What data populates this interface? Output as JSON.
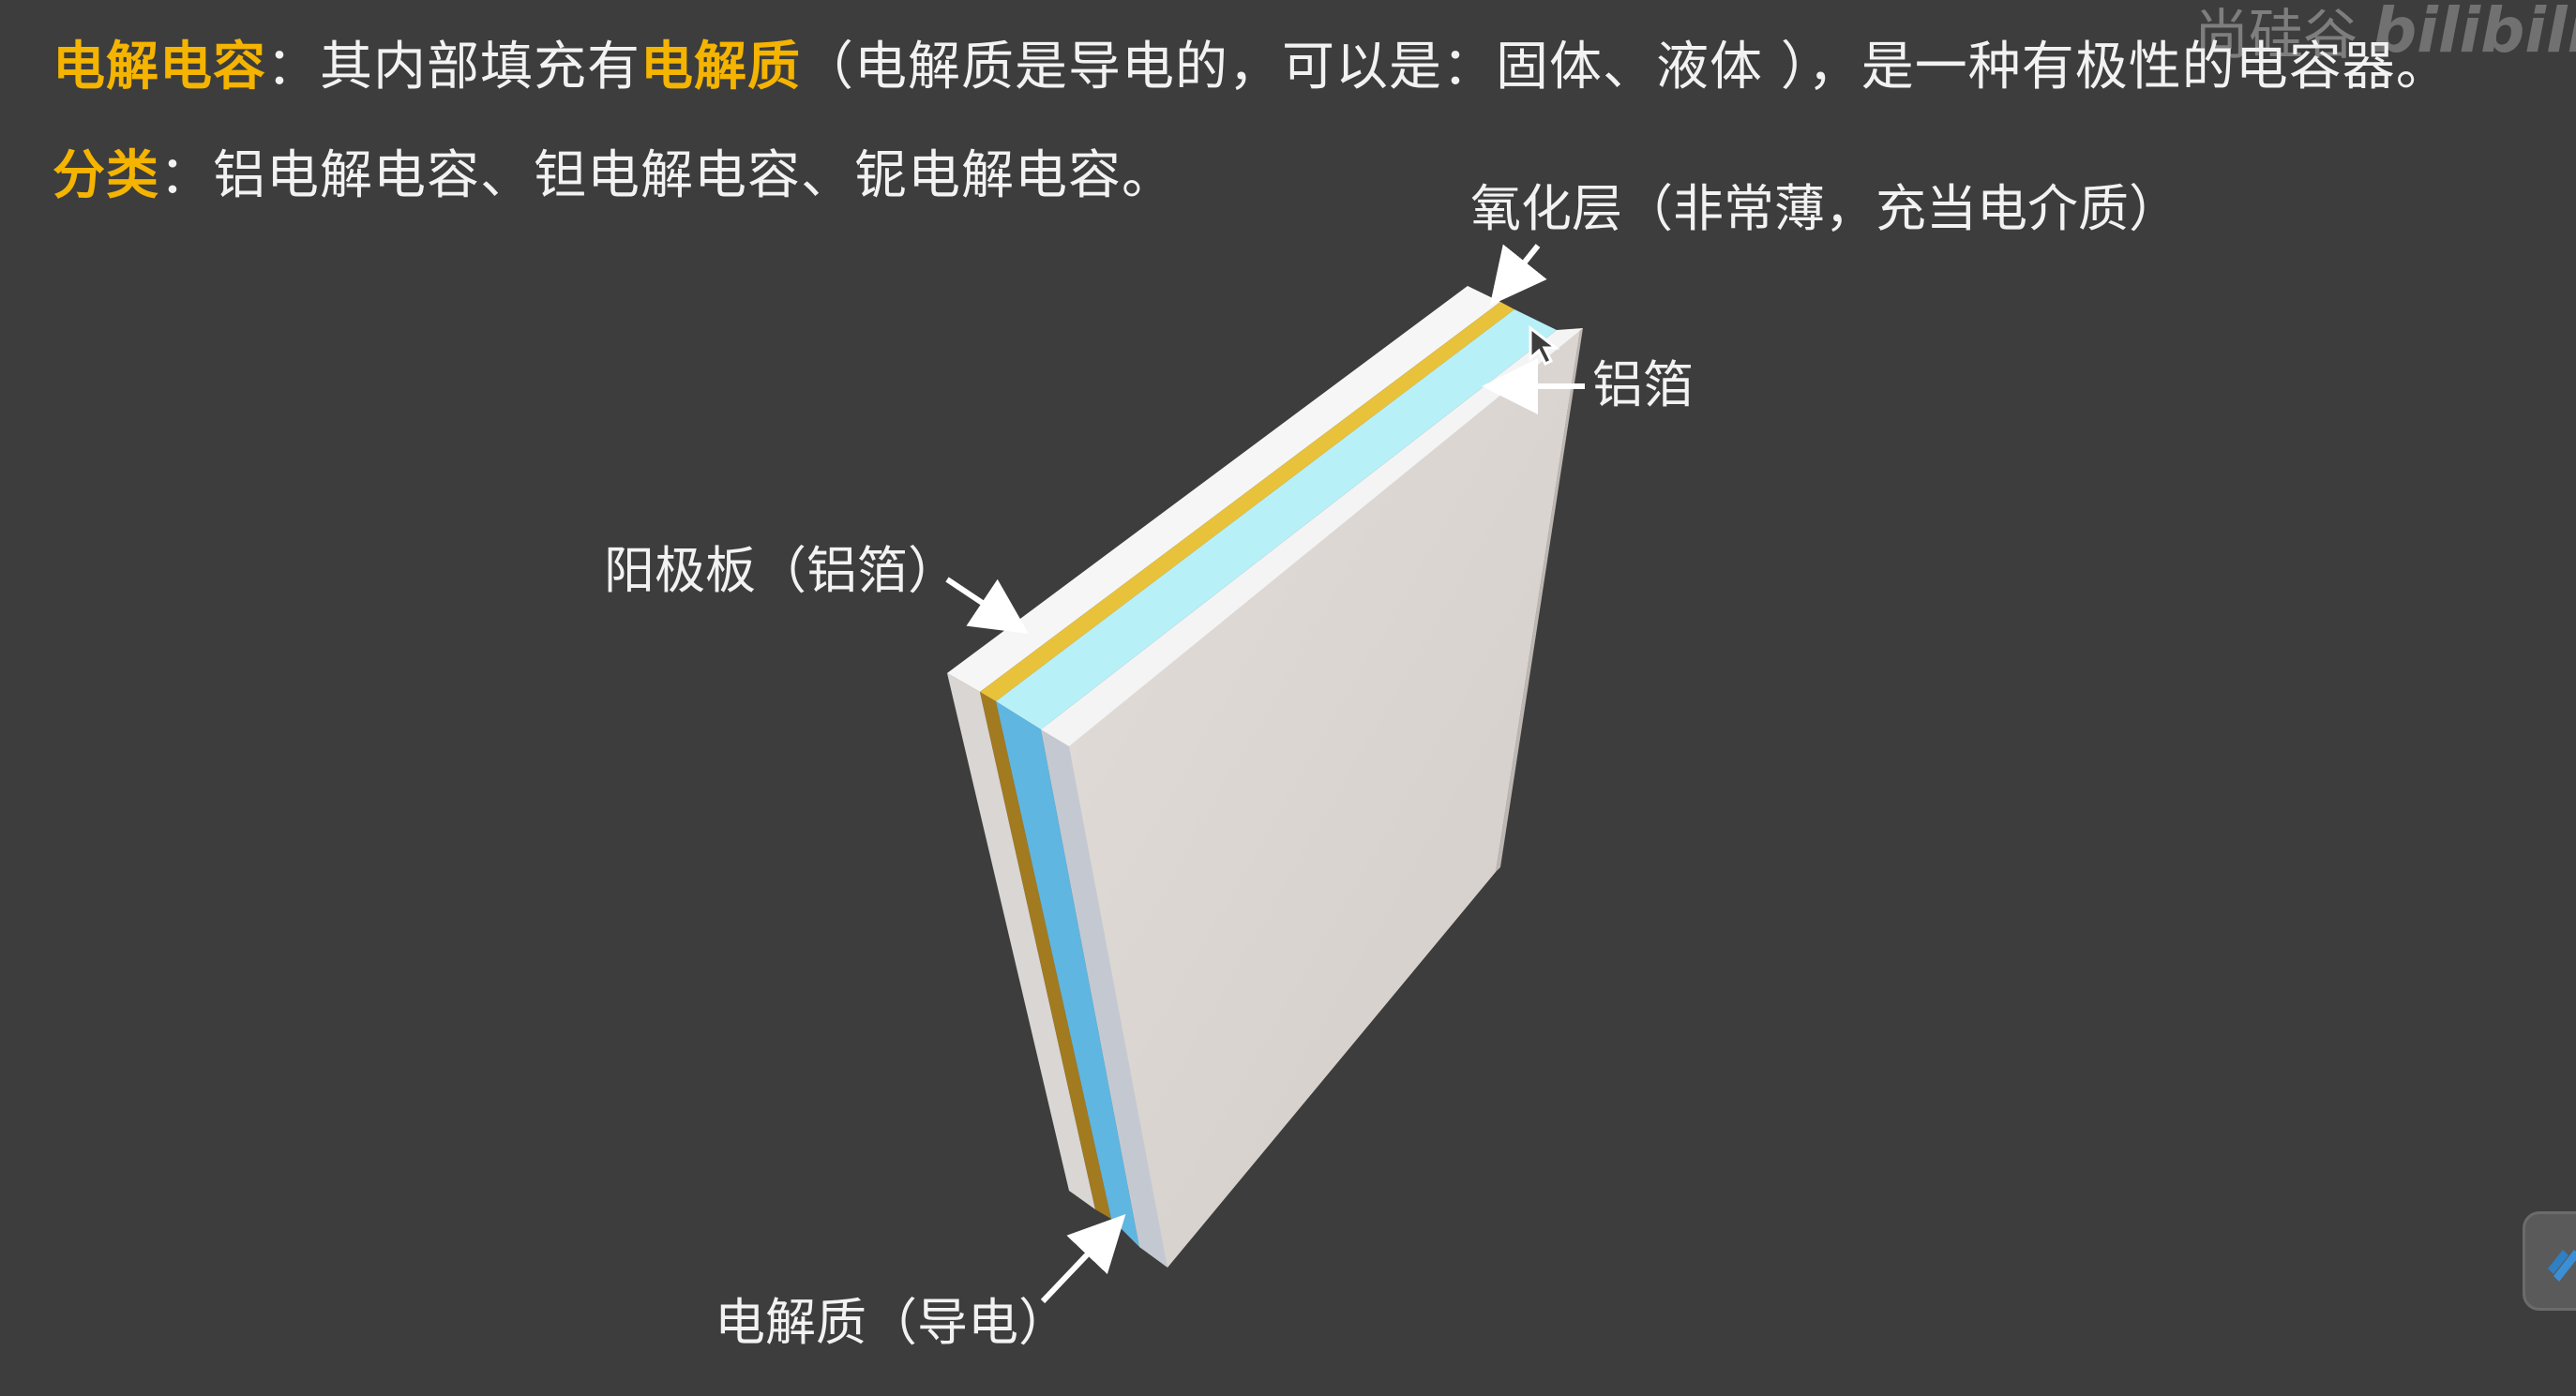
{
  "header": {
    "line1": {
      "term": "电解电容",
      "colon": "：",
      "text_a": "其内部填充有",
      "highlight": "电解质",
      "text_b": "（电解质是导电的，可以是：固体、液体 ），是一种有极性的电容器。"
    },
    "line2": {
      "term": "分类",
      "colon": "：",
      "text": "铝电解电容、钽电解电容、铌电解电容。"
    }
  },
  "labels": {
    "oxide_layer": "氧化层（非常薄，充当电介质）",
    "aluminum_foil": "铝箔",
    "anode_plate": "阳极板（铝箔）",
    "electrolyte": "电解质（导电）"
  },
  "watermark": {
    "brand": "尚硅谷",
    "platform": "bilibili"
  },
  "icons": {
    "cursor": "cursor-icon",
    "side_button": "pencil-icon"
  },
  "colors": {
    "background": "#3d3d3d",
    "highlight": "#f4b400",
    "text": "#f2f2f2",
    "oxide_layer": "#e8c23a",
    "electrolyte": "#b8f0f8",
    "foil": "#f4f4f4",
    "face": "#d9d3cf"
  }
}
